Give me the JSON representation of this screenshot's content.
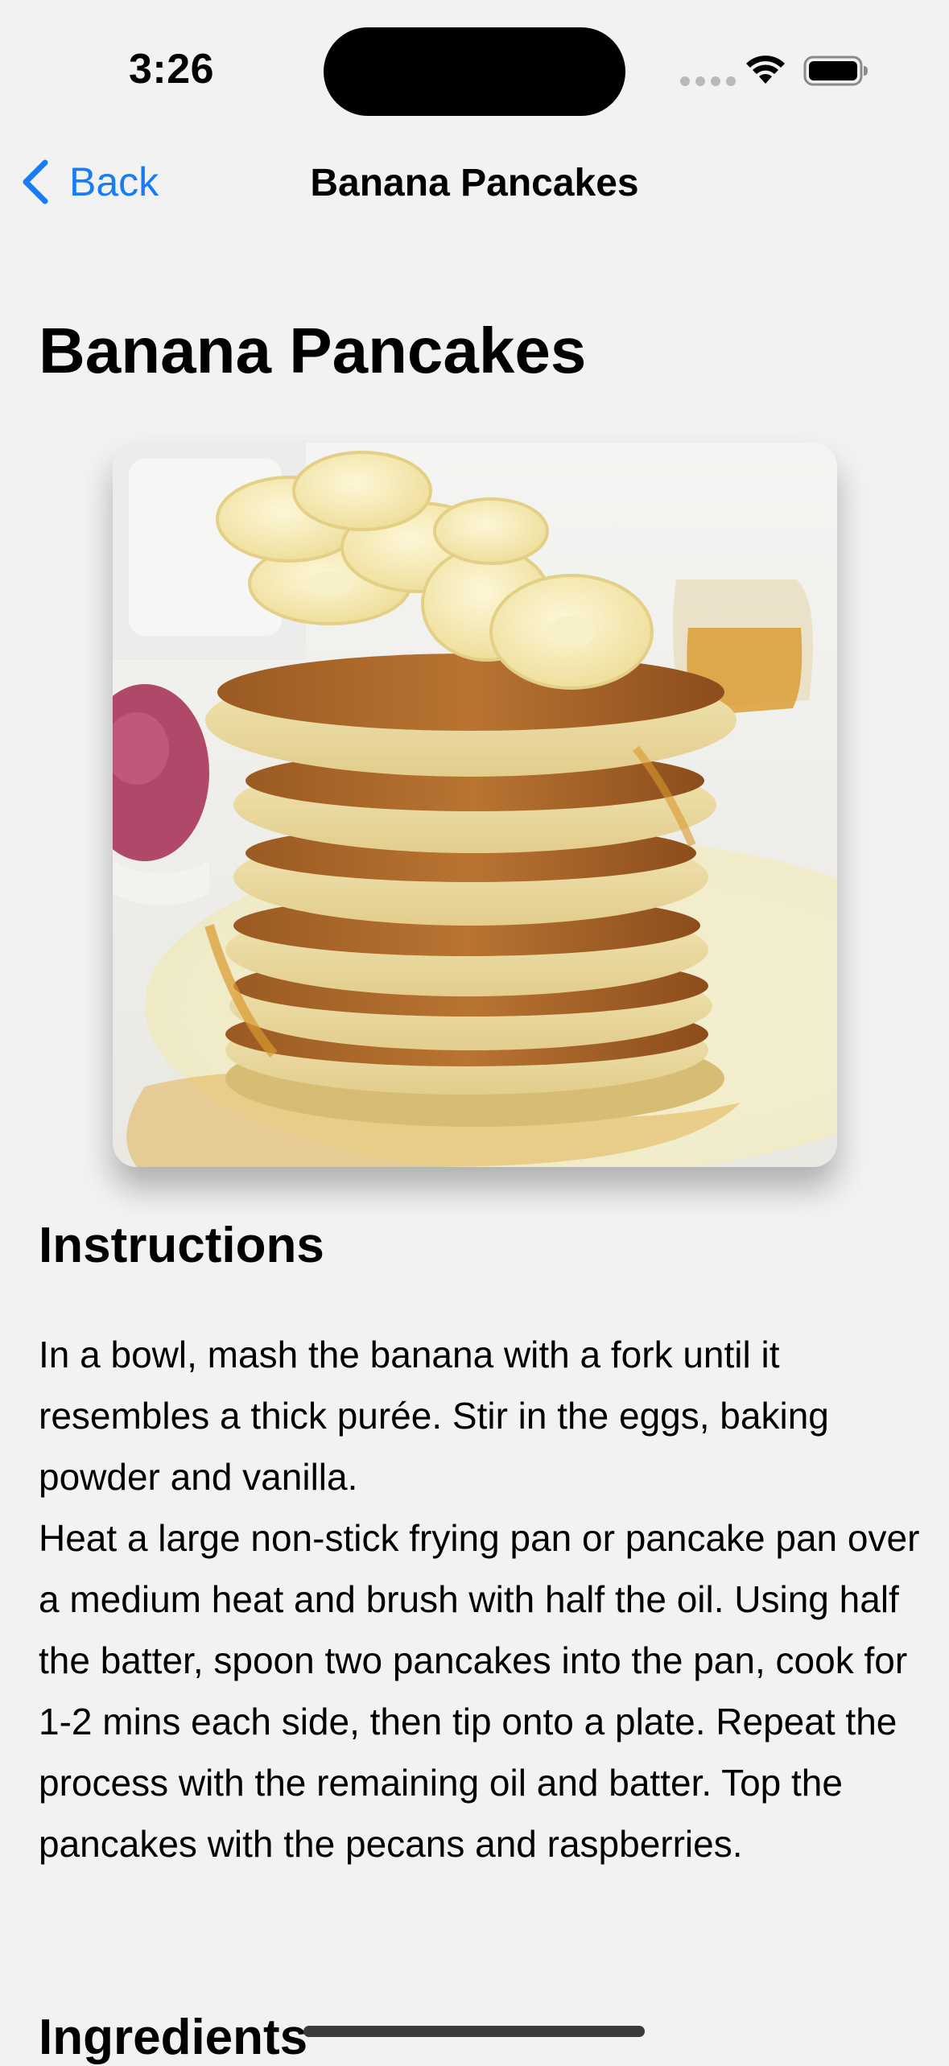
{
  "status_bar": {
    "time": "3:26"
  },
  "nav": {
    "back_label": "Back",
    "title": "Banana Pancakes"
  },
  "recipe": {
    "title": "Banana Pancakes",
    "instructions_heading": "Instructions",
    "instructions": [
      "In a bowl, mash the banana with a fork until it resembles a thick purée. Stir in the eggs, baking powder and vanilla.",
      "Heat a large non-stick frying pan or pancake pan over a medium heat and brush with half the oil. Using half the batter, spoon two pancakes into the pan, cook for 1-2 mins each side, then tip onto a plate. Repeat the process with the remaining oil and batter. Top the pancakes with the pecans and raspberries."
    ],
    "ingredients_heading": "Ingredients"
  },
  "colors": {
    "accent": "#1a7cf5",
    "background": "#f2f2f2"
  },
  "icons": {
    "back": "chevron-left-icon",
    "wifi": "wifi-icon",
    "battery": "battery-icon"
  }
}
